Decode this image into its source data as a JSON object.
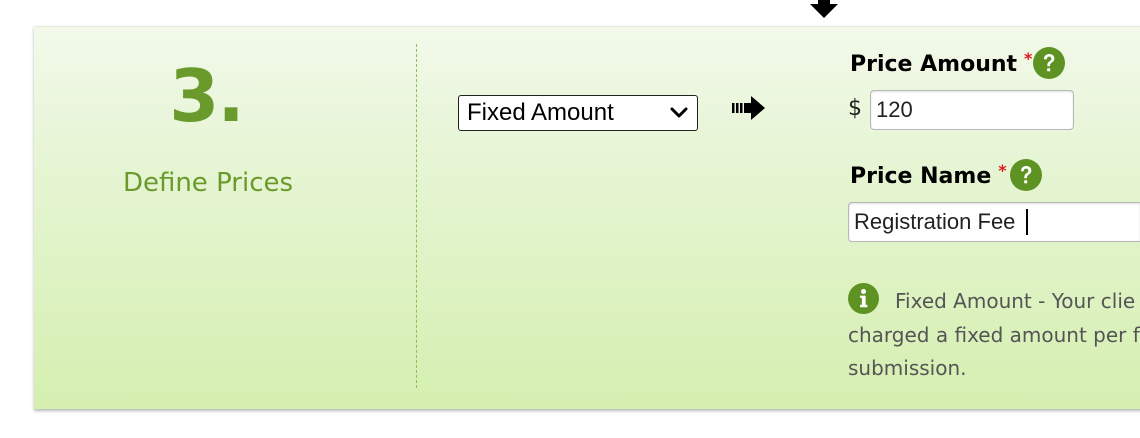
{
  "step": {
    "number": "3.",
    "title": "Define Prices"
  },
  "price_type": {
    "selected": "Fixed Amount"
  },
  "price_amount": {
    "label": "Price Amount",
    "required_marker": "*",
    "currency_symbol": "$",
    "value": "120"
  },
  "price_name": {
    "label": "Price Name",
    "required_marker": "*",
    "value": "Registration Fee"
  },
  "info": {
    "lines": [
      "Fixed Amount - Your clie",
      "charged a fixed amount per fo",
      "submission."
    ]
  },
  "icons": {
    "top": "down-arrow-icon",
    "flow": "right-arrow-icon",
    "help": "question-circle-icon",
    "info": "info-circle-icon",
    "select": "chevron-down-icon"
  },
  "colors": {
    "accent_green": "#6a9a2b",
    "icon_green": "#5e9323",
    "required_red": "#e3181d",
    "panel_top": "#f2f9ea",
    "panel_bottom": "#d5efb0"
  }
}
